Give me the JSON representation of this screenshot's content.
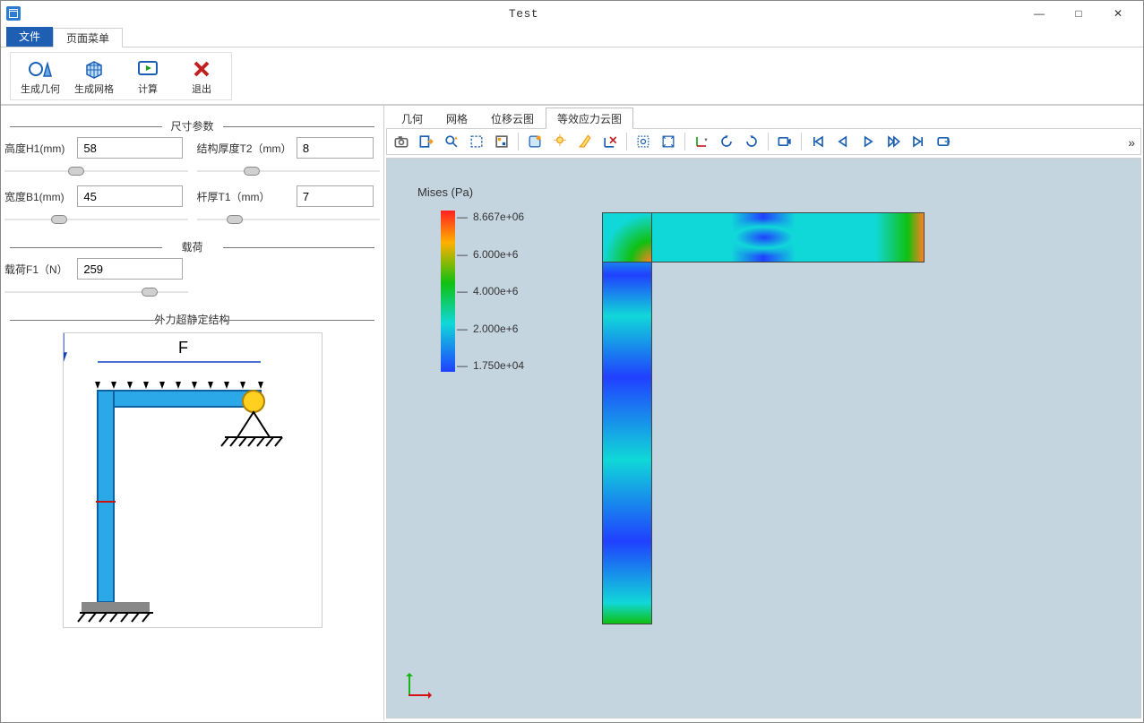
{
  "window": {
    "title": "Test",
    "minimize": "—",
    "maximize": "□",
    "close": "✕"
  },
  "ribbon_tabs": {
    "file": "文件",
    "page_menu": "页面菜单"
  },
  "ribbon_buttons": {
    "gen_geom": "生成几何",
    "gen_mesh": "生成网格",
    "compute": "计算",
    "exit": "退出"
  },
  "sections": {
    "size_params": "尺寸参数",
    "load": "载荷",
    "diagram": "外力超静定结构"
  },
  "params": {
    "h1": {
      "label": "高度H1(mm)",
      "value": "58"
    },
    "t2": {
      "label": "结构厚度T2（mm）",
      "value": "8"
    },
    "b1": {
      "label": "宽度B1(mm)",
      "value": "45"
    },
    "t1": {
      "label": "杆厚T1（mm）",
      "value": "7"
    },
    "f1": {
      "label": "载荷F1（N）",
      "value": "259"
    }
  },
  "diagram_label": "F",
  "view_tabs": [
    "几何",
    "网格",
    "位移云图",
    "等效应力云图"
  ],
  "view_tabs_active_index": 3,
  "toolbar_icons": [
    "camera-icon",
    "export-icon",
    "magic-zoom-icon",
    "select-area-icon",
    "color-by-icon",
    "surface-icon",
    "light-icon",
    "ruler-icon",
    "delete-axis-icon",
    "zoom-box-icon",
    "fit-all-icon",
    "axis-dropdown-icon",
    "rotate-ccw-icon",
    "rotate-cw-icon",
    "record-icon",
    "first-frame-icon",
    "prev-frame-icon",
    "play-icon",
    "next-frame-icon",
    "last-frame-icon",
    "loop-icon"
  ],
  "separators_after": [
    4,
    8,
    10,
    13,
    14
  ],
  "toolbar_overflow": "»",
  "legend": {
    "title": "Mises (Pa)",
    "ticks": [
      "8.667e+06",
      "6.000e+6",
      "4.000e+6",
      "2.000e+6",
      "1.750e+04"
    ]
  }
}
